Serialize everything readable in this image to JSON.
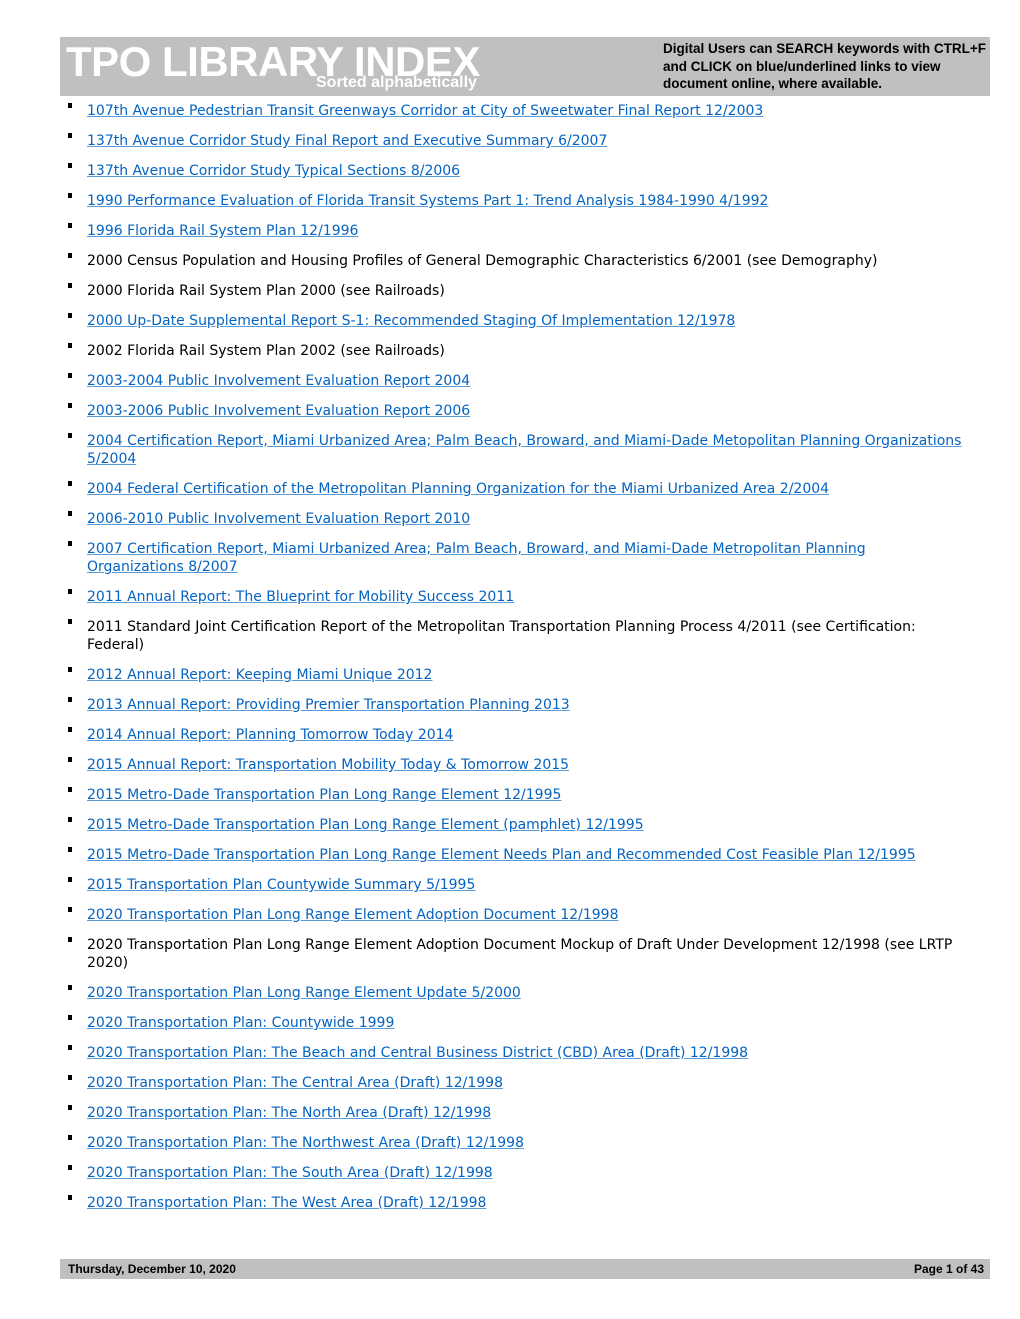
{
  "header": {
    "title": "TPO LIBRARY INDEX",
    "subtitle": "Sorted alphabetically",
    "instructions": "Digital Users can SEARCH keywords with CTRL+F and CLICK on blue/underlined links to view document online, where available."
  },
  "colors": {
    "link": "#0563c1",
    "header_bg": "#c0c0c0"
  },
  "entries": [
    {
      "text": "107th Avenue Pedestrian Transit Greenways Corridor at City of Sweetwater Final Report 12/2003",
      "link": true
    },
    {
      "text": "137th Avenue Corridor Study Final Report and Executive Summary 6/2007",
      "link": true
    },
    {
      "text": "137th Avenue Corridor Study Typical Sections 8/2006",
      "link": true
    },
    {
      "text": "1990 Performance Evaluation of Florida Transit Systems Part 1: Trend Analysis 1984-1990 4/1992",
      "link": true
    },
    {
      "text": "1996 Florida Rail System Plan 12/1996",
      "link": true
    },
    {
      "text": "2000 Census Population and Housing Profiles of General Demographic Characteristics 6/2001 (see Demography)",
      "link": false
    },
    {
      "text": "2000 Florida Rail System Plan 2000 (see Railroads)",
      "link": false
    },
    {
      "text": "2000 Up-Date Supplemental Report S-1: Recommended Staging Of Implementation 12/1978",
      "link": true
    },
    {
      "text": "2002 Florida Rail System Plan 2002 (see Railroads)",
      "link": false
    },
    {
      "text": "2003-2004 Public Involvement Evaluation Report 2004",
      "link": true
    },
    {
      "text": "2003-2006 Public Involvement Evaluation Report 2006",
      "link": true
    },
    {
      "text": "2004 Certification Report, Miami Urbanized Area; Palm Beach, Broward, and Miami-Dade Metopolitan Planning Organizations 5/2004",
      "link": true
    },
    {
      "text": "2004 Federal Certification of the Metropolitan Planning Organization for the Miami Urbanized Area 2/2004",
      "link": true
    },
    {
      "text": "2006-2010 Public Involvement Evaluation Report 2010",
      "link": true
    },
    {
      "text": "2007 Certification Report, Miami Urbanized Area; Palm Beach, Broward, and Miami-Dade Metropolitan Planning Organizations 8/2007",
      "link": true
    },
    {
      "text": "2011 Annual Report: The Blueprint for Mobility Success 2011",
      "link": true
    },
    {
      "text": "2011 Standard Joint Certification Report of the Metropolitan Transportation Planning Process 4/2011 (see Certification: Federal)",
      "link": false
    },
    {
      "text": "2012 Annual Report: Keeping Miami Unique 2012",
      "link": true
    },
    {
      "text": "2013 Annual Report: Providing Premier Transportation Planning 2013",
      "link": true
    },
    {
      "text": "2014 Annual Report: Planning Tomorrow Today 2014",
      "link": true
    },
    {
      "text": "2015 Annual Report: Transportation Mobility Today & Tomorrow 2015",
      "link": true
    },
    {
      "text": "2015 Metro-Dade Transportation Plan Long Range Element 12/1995",
      "link": true
    },
    {
      "text": "2015 Metro-Dade Transportation Plan Long Range Element (pamphlet) 12/1995",
      "link": true
    },
    {
      "text": "2015 Metro-Dade Transportation Plan Long Range Element Needs Plan and Recommended Cost Feasible Plan 12/1995",
      "link": true
    },
    {
      "text": "2015 Transportation Plan Countywide Summary 5/1995",
      "link": true
    },
    {
      "text": "2020 Transportation Plan Long Range Element Adoption Document 12/1998",
      "link": true
    },
    {
      "text": "2020 Transportation Plan Long Range Element Adoption Document Mockup of Draft Under Development 12/1998 (see LRTP 2020)",
      "link": false
    },
    {
      "text": "2020 Transportation Plan Long Range Element Update 5/2000",
      "link": true
    },
    {
      "text": "2020 Transportation Plan: Countywide 1999",
      "link": true
    },
    {
      "text": "2020 Transportation Plan: The Beach and Central Business District (CBD) Area (Draft) 12/1998",
      "link": true
    },
    {
      "text": "2020 Transportation Plan: The Central Area (Draft) 12/1998",
      "link": true
    },
    {
      "text": "2020 Transportation Plan: The North Area (Draft) 12/1998",
      "link": true
    },
    {
      "text": "2020 Transportation Plan: The Northwest Area (Draft) 12/1998",
      "link": true
    },
    {
      "text": "2020 Transportation Plan: The South Area (Draft) 12/1998",
      "link": true
    },
    {
      "text": "2020 Transportation Plan: The West Area (Draft) 12/1998",
      "link": true
    }
  ],
  "footer": {
    "date": "Thursday, December 10, 2020",
    "page": "Page 1 of 43"
  }
}
